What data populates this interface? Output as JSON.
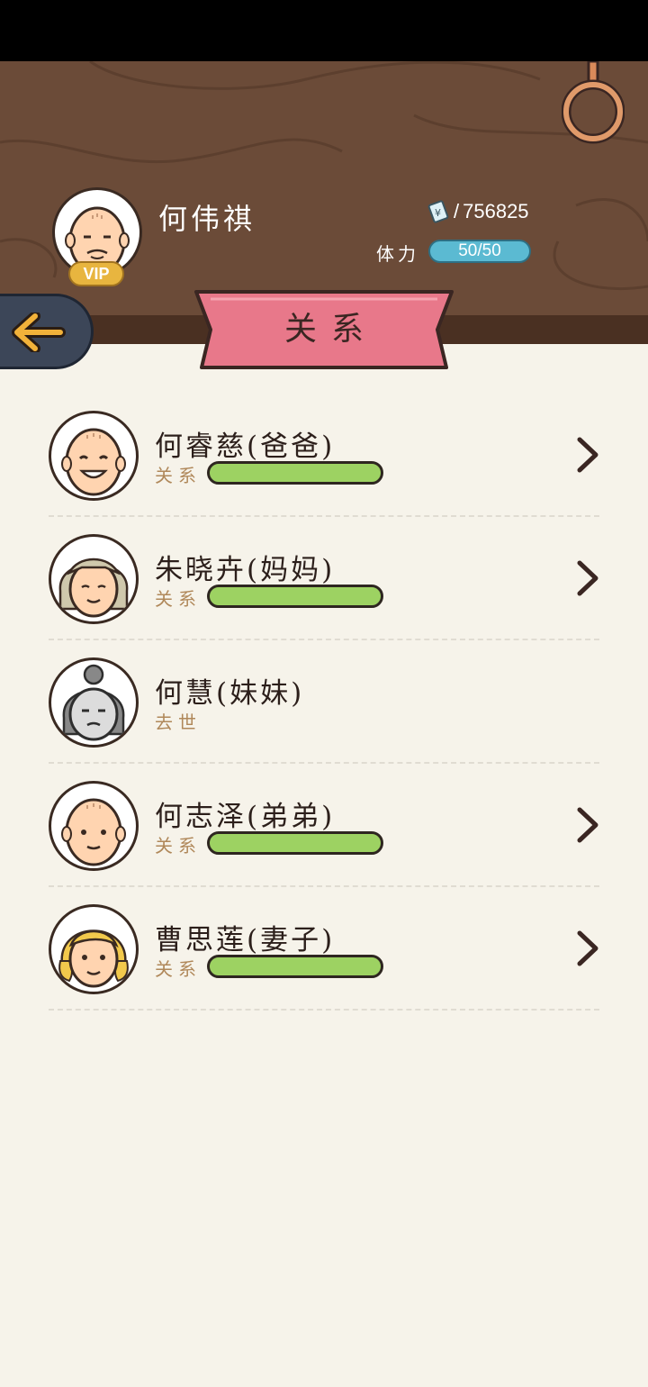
{
  "player": {
    "name": "何伟祺",
    "vip_label": "VIP",
    "money_value": "756825",
    "money_icon": "money-note-icon",
    "stamina_label": "体力",
    "stamina_value": "50/50",
    "stamina_fraction": 1.0
  },
  "page": {
    "title": "关系",
    "back_icon": "arrow-left-icon"
  },
  "relations": [
    {
      "name": "何睿慈(爸爸)",
      "sub": "关系",
      "relation_level": 1.0,
      "has_detail": true,
      "status": "alive",
      "avatar": "old-man-bald-smiling"
    },
    {
      "name": "朱晓卉(妈妈)",
      "sub": "关系",
      "relation_level": 1.0,
      "has_detail": true,
      "status": "alive",
      "avatar": "old-woman-gray-hair"
    },
    {
      "name": "何慧(妹妹)",
      "sub": "去世",
      "has_detail": false,
      "status": "deceased",
      "avatar": "old-woman-bun-grayscale"
    },
    {
      "name": "何志泽(弟弟)",
      "sub": "关系",
      "relation_level": 1.0,
      "has_detail": true,
      "status": "alive",
      "avatar": "bald-man"
    },
    {
      "name": "曹思莲(妻子)",
      "sub": "关系",
      "relation_level": 1.0,
      "has_detail": true,
      "status": "alive",
      "avatar": "blonde-woman-pigtails"
    }
  ],
  "colors": {
    "header_wood": "#6b4b38",
    "ribbon_pink": "#e8788a",
    "relation_bar": "#9dd262",
    "stamina_bar": "#5bbad2",
    "vip_gold": "#e8b53f",
    "background": "#f6f3ea"
  }
}
